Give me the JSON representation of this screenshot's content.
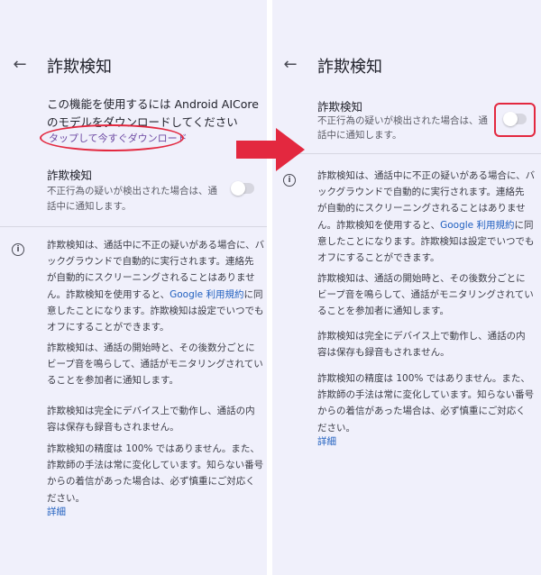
{
  "left": {
    "title": "詐欺検知",
    "download_line1": "この機能を使用するには Android AICore",
    "download_line2": "のモデルをダウンロードしてください",
    "download_link": "タップして今すぐダウンロード",
    "setting_title": "詐欺検知",
    "setting_sub_line1": "不正行為の疑いが検出された場合は、通",
    "setting_sub_line2": "話中に通知します。",
    "toggle_on": false,
    "info_p1_lines": [
      "詐欺検知は、通話中に不正の疑いがある場合に、バ",
      "ックグラウンドで自動的に実行されます。連絡先",
      "が自動的にスクリーニングされることはありませ",
      "ん。詐欺検知を使用すると、"
    ],
    "info_p1_link": "Google 利用規約",
    "info_p1_after_link": "に同",
    "info_p1_tail": [
      "意したことになります。詐欺検知は設定でいつでも",
      "オフにすることができます。"
    ],
    "info_p2_lines": [
      "詐欺検知は、通話の開始時と、その後数分ごとに",
      "ビープ音を鳴らして、通話がモニタリングされてい",
      "ることを参加者に通知します。"
    ],
    "info_p3_lines": [
      "詐欺検知は完全にデバイス上で動作し、通話の内",
      "容は保存も録音もされません。"
    ],
    "info_p4_lines": [
      "詐欺検知の精度は 100% ではありません。また、",
      "詐欺師の手法は常に変化しています。知らない番号",
      "からの着信があった場合は、必ず慎重にご対応く",
      "ださい。"
    ],
    "detail_link": "詳細"
  },
  "right": {
    "title": "詐欺検知",
    "setting_title": "詐欺検知",
    "setting_sub_line1": "不正行為の疑いが検出された場合は、通",
    "setting_sub_line2": "話中に通知します。",
    "toggle_on": false,
    "info_p1_lines": [
      "詐欺検知は、通話中に不正の疑いがある場合に、バ",
      "ックグラウンドで自動的に実行されます。連絡先",
      "が自動的にスクリーニングされることはありませ",
      "ん。詐欺検知を使用すると、"
    ],
    "info_p1_link": "Google 利用規約",
    "info_p1_after_link": "に同",
    "info_p1_tail": [
      "意したことになります。詐欺検知は設定でいつでも",
      "オフにすることができます。"
    ],
    "info_p2_lines": [
      "詐欺検知は、通話の開始時と、その後数分ごとに",
      "ビープ音を鳴らして、通話がモニタリングされてい",
      "ることを参加者に通知します。"
    ],
    "info_p3_lines": [
      "詐欺検知は完全にデバイス上で動作し、通話の内",
      "容は保存も録音もされません。"
    ],
    "info_p4_lines": [
      "詐欺検知の精度は 100% ではありません。また、",
      "詐欺師の手法は常に変化しています。知らない番号",
      "からの着信があった場合は、必ず慎重にご対応く",
      "ださい。"
    ],
    "detail_link": "詳細"
  },
  "colors": {
    "panel_bg": "#f0f0fb",
    "link": "#1f5fbf",
    "annotation_red": "#e3283f",
    "toggle_track": "#d6d6df"
  },
  "icons": {
    "back": "arrow-left",
    "info": "info-circle",
    "annotation_arrow": "arrow-right"
  }
}
